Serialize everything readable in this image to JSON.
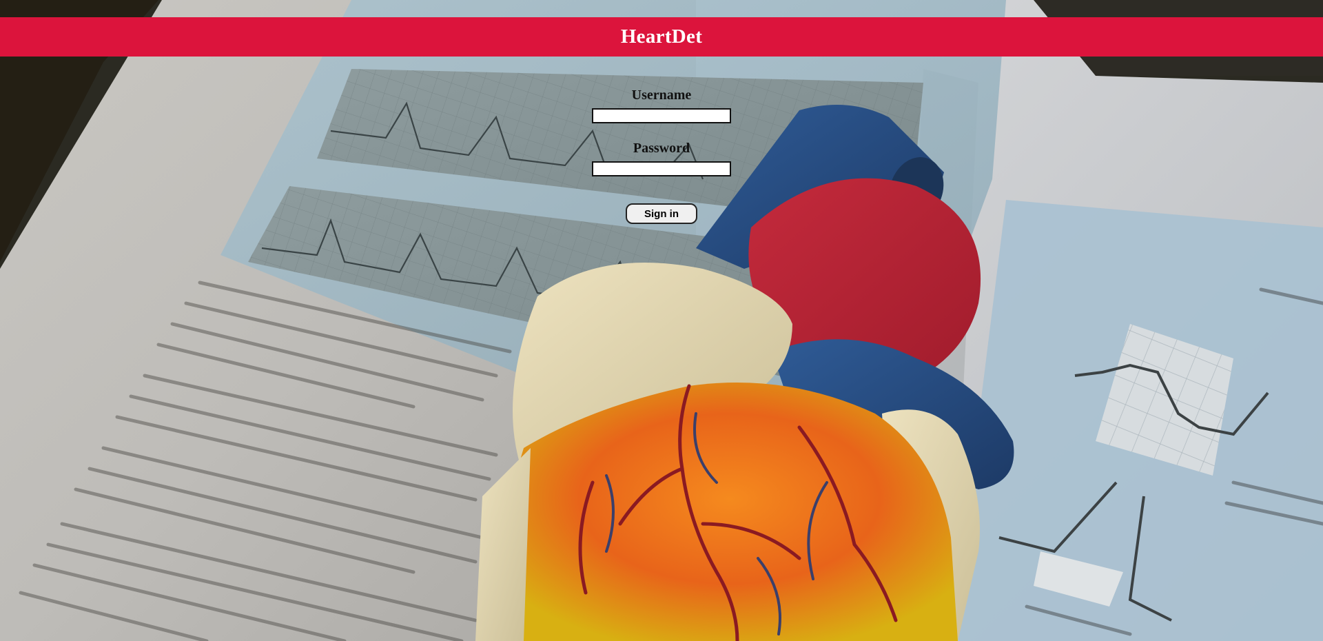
{
  "app": {
    "title": "HeartDet"
  },
  "login": {
    "username_label": "Username",
    "username_value": "",
    "password_label": "Password",
    "password_value": "",
    "signin_label": "Sign in"
  },
  "theme": {
    "header_color": "#dc143c",
    "header_text_color": "#ffffff"
  },
  "background": {
    "description_icon": "heart-model-on-ecg-book-photo"
  }
}
